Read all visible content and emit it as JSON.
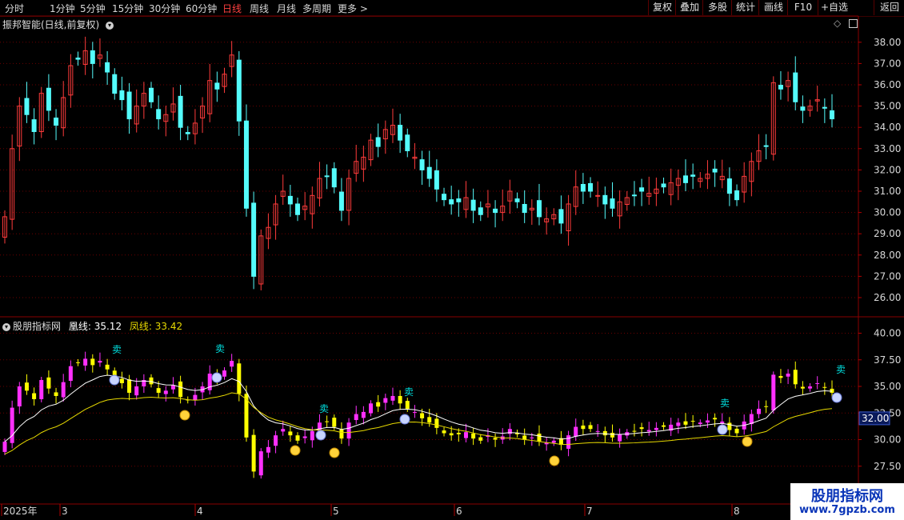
{
  "toolbar": {
    "periods": [
      "分时",
      "1分钟",
      "5分钟",
      "15分钟",
      "30分钟",
      "60分钟",
      "日线",
      "周线",
      "月线",
      "多周期",
      "更多 >"
    ],
    "active_period": "日线",
    "right_buttons": [
      "复权",
      "叠加",
      "多股",
      "统计",
      "画线",
      "F10",
      "+自选",
      "返回"
    ]
  },
  "main_panel": {
    "title": "振邦智能(日线,前复权)",
    "price_axis_labels": [
      "38.00",
      "37.00",
      "36.00",
      "35.00",
      "34.00",
      "33.00",
      "32.00",
      "31.00",
      "30.00",
      "29.00",
      "28.00",
      "27.00",
      "26.00"
    ],
    "colors": {
      "up": "#ff3b3b",
      "down": "#54fcfc",
      "grid": "#7a0000",
      "axis_text": "#d8d8d8"
    }
  },
  "indicator_panel": {
    "title": "股朋指标网",
    "line1_label": "凰线:",
    "line1_value": "35.12",
    "line2_label": "凤线:",
    "line2_value": "33.42",
    "axis_labels": [
      "40.00",
      "37.50",
      "35.00",
      "32.50",
      "30.00",
      "27.50"
    ],
    "cursor_value": "32.00",
    "sell_label": "卖",
    "colors": {
      "up": "#ff30ff",
      "down": "#ffff00",
      "line1": "#ffffff",
      "line2": "#e6d800",
      "sell": "#00e0e0"
    }
  },
  "date_axis": {
    "labels": [
      "2025年",
      "3",
      "4",
      "5",
      "6",
      "7",
      "8"
    ]
  },
  "watermark": {
    "line1": "股朋指标网",
    "line2": "www.7gpzb.com"
  }
}
